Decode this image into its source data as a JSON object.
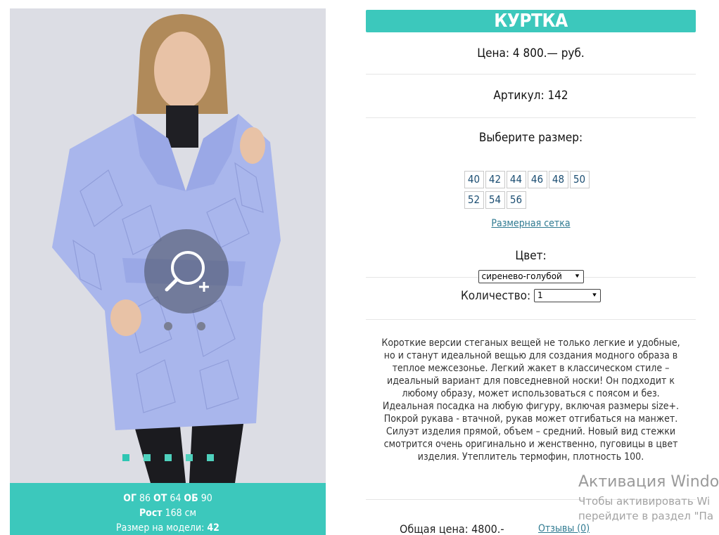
{
  "product": {
    "title": "КУРТКА",
    "price": "Цена: 4 800.— руб.",
    "sku": "Артикул: 142",
    "size_label": "Выберите размер:",
    "sizes": [
      "40",
      "42",
      "44",
      "46",
      "48",
      "50",
      "52",
      "54",
      "56"
    ],
    "size_grid_link": "Размерная сетка",
    "color_label": "Цвет:",
    "color_value": "сиренево-голубой",
    "quantity_label": "Количество:",
    "quantity_value": "1",
    "description": "Короткие версии стеганых вещей не только легкие и удобные, но и станут идеальной вещью для создания модного образа в теплое межсезонье. Легкий жакет в классическом стиле – идеальный вариант для повседневной носки! Он подходит к любому образу, может использоваться с поясом и без. Идеальная посадка на любую фигуру, включая размеры size+. Покрой рукава - втачной, рукав может отгибаться на манжет. Силуэт изделия прямой, объем – средний. Новый вид стежки смотрится очень оригинально и женственно, пуговицы в цвет изделия. Утеплитель термофин, плотность 100.",
    "total": "Общая цена: 4800.-",
    "reviews_link": "Отзывы (0)"
  },
  "model": {
    "og_label": "ОГ",
    "og_value": "86",
    "ot_label": "ОТ",
    "ot_value": "64",
    "ob_label": "ОБ",
    "ob_value": "90",
    "height_label": "Рост",
    "height_value": "168 см",
    "size_label": "Размер на модели:",
    "size_value": "42"
  },
  "gallery": {
    "dots": 5,
    "active_dot": 0
  },
  "overlay": {
    "activation_title": "Активация Windo",
    "activation_line1": "Чтобы активировать Wi",
    "activation_line2": "перейдите в раздел \"Па"
  },
  "colors": {
    "accent": "#3cc8bc",
    "jacket": "#a9b6ec",
    "link": "#2f7a91"
  },
  "icons": {
    "zoom": "zoom-in-icon"
  }
}
